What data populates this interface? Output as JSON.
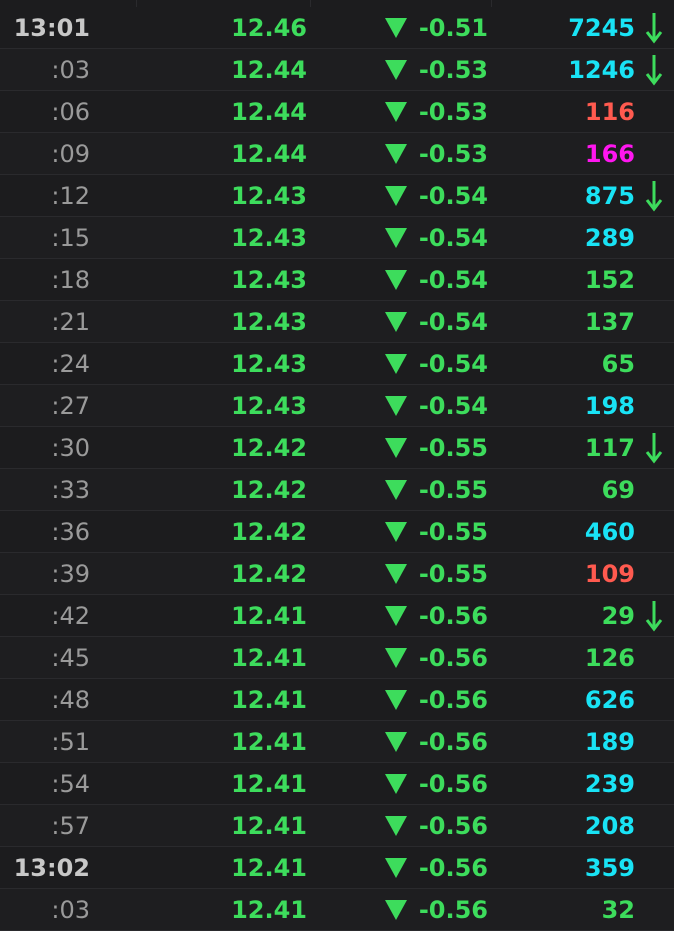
{
  "colors": {
    "down": "#3ddc5c",
    "vol_green": "#3ddc5c",
    "vol_cyan": "#19e3f5",
    "vol_red": "#ff5a4f",
    "vol_magenta": "#ff16f0"
  },
  "ticks": [
    {
      "time": "13:01",
      "minute": true,
      "price": "12.46",
      "change": "-0.51",
      "direction": "down-triangle-icon",
      "volume": "7245",
      "vol_color": "cyan",
      "arrow": true
    },
    {
      "time": ":03",
      "minute": false,
      "price": "12.44",
      "change": "-0.53",
      "direction": "down-triangle-icon",
      "volume": "1246",
      "vol_color": "cyan",
      "arrow": true
    },
    {
      "time": ":06",
      "minute": false,
      "price": "12.44",
      "change": "-0.53",
      "direction": "down-triangle-icon",
      "volume": "116",
      "vol_color": "red",
      "arrow": false
    },
    {
      "time": ":09",
      "minute": false,
      "price": "12.44",
      "change": "-0.53",
      "direction": "down-triangle-icon",
      "volume": "166",
      "vol_color": "magenta",
      "arrow": false
    },
    {
      "time": ":12",
      "minute": false,
      "price": "12.43",
      "change": "-0.54",
      "direction": "down-triangle-icon",
      "volume": "875",
      "vol_color": "cyan",
      "arrow": true
    },
    {
      "time": ":15",
      "minute": false,
      "price": "12.43",
      "change": "-0.54",
      "direction": "down-triangle-icon",
      "volume": "289",
      "vol_color": "cyan",
      "arrow": false
    },
    {
      "time": ":18",
      "minute": false,
      "price": "12.43",
      "change": "-0.54",
      "direction": "down-triangle-icon",
      "volume": "152",
      "vol_color": "green",
      "arrow": false
    },
    {
      "time": ":21",
      "minute": false,
      "price": "12.43",
      "change": "-0.54",
      "direction": "down-triangle-icon",
      "volume": "137",
      "vol_color": "green",
      "arrow": false
    },
    {
      "time": ":24",
      "minute": false,
      "price": "12.43",
      "change": "-0.54",
      "direction": "down-triangle-icon",
      "volume": "65",
      "vol_color": "green",
      "arrow": false
    },
    {
      "time": ":27",
      "minute": false,
      "price": "12.43",
      "change": "-0.54",
      "direction": "down-triangle-icon",
      "volume": "198",
      "vol_color": "cyan",
      "arrow": false
    },
    {
      "time": ":30",
      "minute": false,
      "price": "12.42",
      "change": "-0.55",
      "direction": "down-triangle-icon",
      "volume": "117",
      "vol_color": "green",
      "arrow": true
    },
    {
      "time": ":33",
      "minute": false,
      "price": "12.42",
      "change": "-0.55",
      "direction": "down-triangle-icon",
      "volume": "69",
      "vol_color": "green",
      "arrow": false
    },
    {
      "time": ":36",
      "minute": false,
      "price": "12.42",
      "change": "-0.55",
      "direction": "down-triangle-icon",
      "volume": "460",
      "vol_color": "cyan",
      "arrow": false
    },
    {
      "time": ":39",
      "minute": false,
      "price": "12.42",
      "change": "-0.55",
      "direction": "down-triangle-icon",
      "volume": "109",
      "vol_color": "red",
      "arrow": false
    },
    {
      "time": ":42",
      "minute": false,
      "price": "12.41",
      "change": "-0.56",
      "direction": "down-triangle-icon",
      "volume": "29",
      "vol_color": "green",
      "arrow": true
    },
    {
      "time": ":45",
      "minute": false,
      "price": "12.41",
      "change": "-0.56",
      "direction": "down-triangle-icon",
      "volume": "126",
      "vol_color": "green",
      "arrow": false
    },
    {
      "time": ":48",
      "minute": false,
      "price": "12.41",
      "change": "-0.56",
      "direction": "down-triangle-icon",
      "volume": "626",
      "vol_color": "cyan",
      "arrow": false
    },
    {
      "time": ":51",
      "minute": false,
      "price": "12.41",
      "change": "-0.56",
      "direction": "down-triangle-icon",
      "volume": "189",
      "vol_color": "cyan",
      "arrow": false
    },
    {
      "time": ":54",
      "minute": false,
      "price": "12.41",
      "change": "-0.56",
      "direction": "down-triangle-icon",
      "volume": "239",
      "vol_color": "cyan",
      "arrow": false
    },
    {
      "time": ":57",
      "minute": false,
      "price": "12.41",
      "change": "-0.56",
      "direction": "down-triangle-icon",
      "volume": "208",
      "vol_color": "cyan",
      "arrow": false
    },
    {
      "time": "13:02",
      "minute": true,
      "price": "12.41",
      "change": "-0.56",
      "direction": "down-triangle-icon",
      "volume": "359",
      "vol_color": "cyan",
      "arrow": false
    },
    {
      "time": ":03",
      "minute": false,
      "price": "12.41",
      "change": "-0.56",
      "direction": "down-triangle-icon",
      "volume": "32",
      "vol_color": "green",
      "arrow": false
    }
  ]
}
